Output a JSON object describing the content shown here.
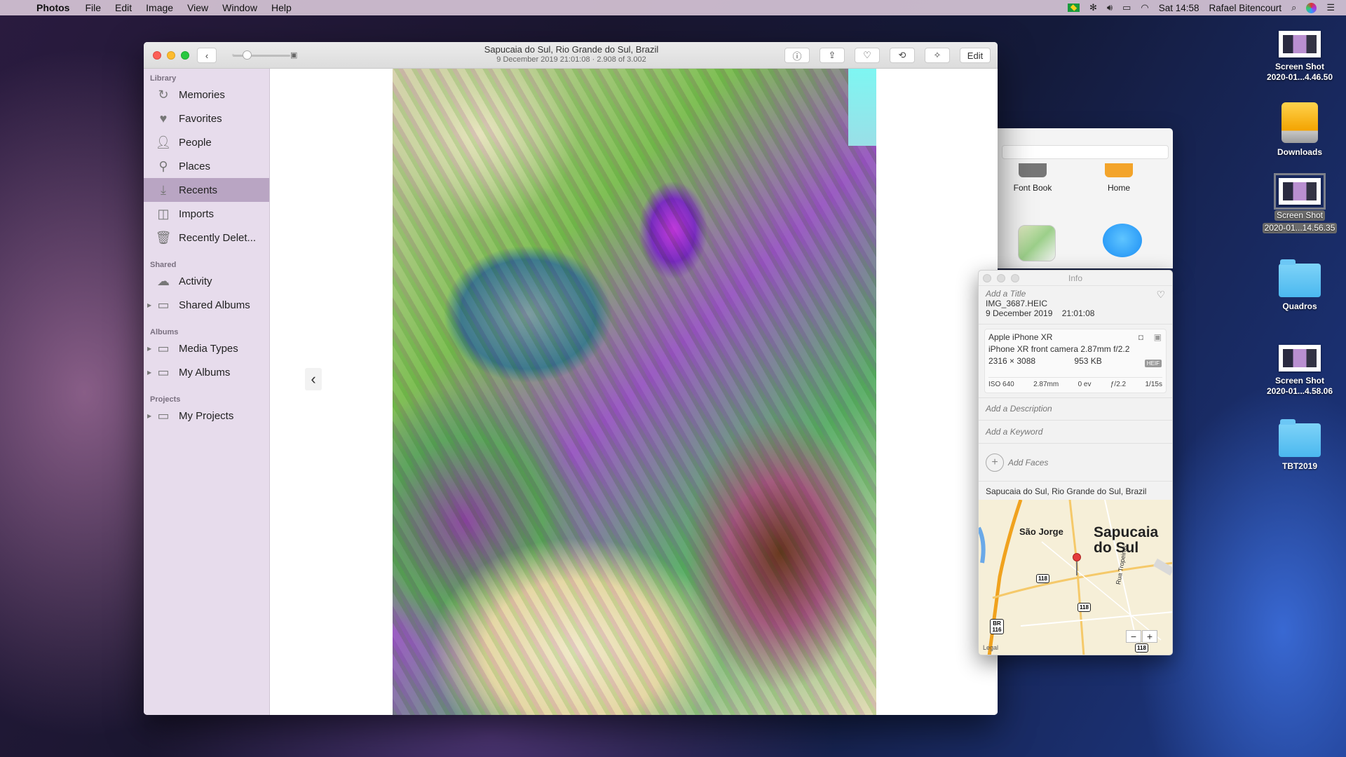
{
  "menubar": {
    "app_name": "Photos",
    "menus": [
      "File",
      "Edit",
      "Image",
      "View",
      "Window",
      "Help"
    ],
    "clock": "Sat 14:58",
    "user": "Rafael Bitencourt"
  },
  "photos_window": {
    "title": "Sapucaia do Sul, Rio Grande do Sul, Brazil",
    "subtitle": "9 December 2019 21:01:08  ·  2.908 of 3.002",
    "edit_label": "Edit",
    "sidebar": {
      "library_label": "Library",
      "library_items": [
        {
          "label": "Memories",
          "icon": "memories-icon"
        },
        {
          "label": "Favorites",
          "icon": "heart-icon"
        },
        {
          "label": "People",
          "icon": "person-icon"
        },
        {
          "label": "Places",
          "icon": "pin-icon"
        },
        {
          "label": "Recents",
          "icon": "recents-icon"
        },
        {
          "label": "Imports",
          "icon": "camera-icon"
        },
        {
          "label": "Recently Delet...",
          "icon": "trash-icon"
        }
      ],
      "shared_label": "Shared",
      "shared_items": [
        {
          "label": "Activity",
          "icon": "cloud-icon"
        },
        {
          "label": "Shared Albums",
          "icon": "folder-icon"
        }
      ],
      "albums_label": "Albums",
      "album_items": [
        {
          "label": "Media Types",
          "icon": "folder-icon"
        },
        {
          "label": "My Albums",
          "icon": "folder-icon"
        }
      ],
      "projects_label": "Projects",
      "project_items": [
        {
          "label": "My Projects",
          "icon": "folder-icon"
        }
      ]
    }
  },
  "launcher": {
    "apps": [
      "Font Book",
      "Home"
    ]
  },
  "info_panel": {
    "title": "Info",
    "title_placeholder": "Add a Title",
    "filename": "IMG_3687.HEIC",
    "date": "9 December 2019",
    "time": "21:01:08",
    "camera": "Apple iPhone XR",
    "lens": "iPhone XR front camera 2.87mm f/2.2",
    "dimensions": "2316 × 3088",
    "file_size": "953 KB",
    "format_badge": "HEIF",
    "exif": [
      "ISO 640",
      "2.87mm",
      "0 ev",
      "ƒ/2.2",
      "1/15s"
    ],
    "description_placeholder": "Add a Description",
    "keyword_placeholder": "Add a Keyword",
    "faces_label": "Add Faces",
    "location": "Sapucaia do Sul, Rio Grande do Sul, Brazil",
    "map": {
      "city_label_line1": "Sapucaia",
      "city_label_line2": "do Sul",
      "neighborhood": "São Jorge",
      "street": "Rua Tropeiros",
      "road_badges": [
        "118",
        "118",
        "118",
        "BR 116"
      ],
      "legal": "Legal"
    }
  },
  "desktop": {
    "icons": [
      {
        "label_line1": "Screen Shot",
        "label_line2": "2020-01...4.46.50",
        "type": "thumb"
      },
      {
        "label_line1": "Downloads",
        "label_line2": "",
        "type": "drive"
      },
      {
        "label_line1": "Screen Shot",
        "label_line2": "2020-01...14.56.35",
        "type": "thumb"
      },
      {
        "label_line1": "Quadros",
        "label_line2": "",
        "type": "folder"
      },
      {
        "label_line1": "Screen Shot",
        "label_line2": "2020-01...4.58.06",
        "type": "thumb"
      },
      {
        "label_line1": "TBT2019",
        "label_line2": "",
        "type": "folder"
      }
    ]
  }
}
